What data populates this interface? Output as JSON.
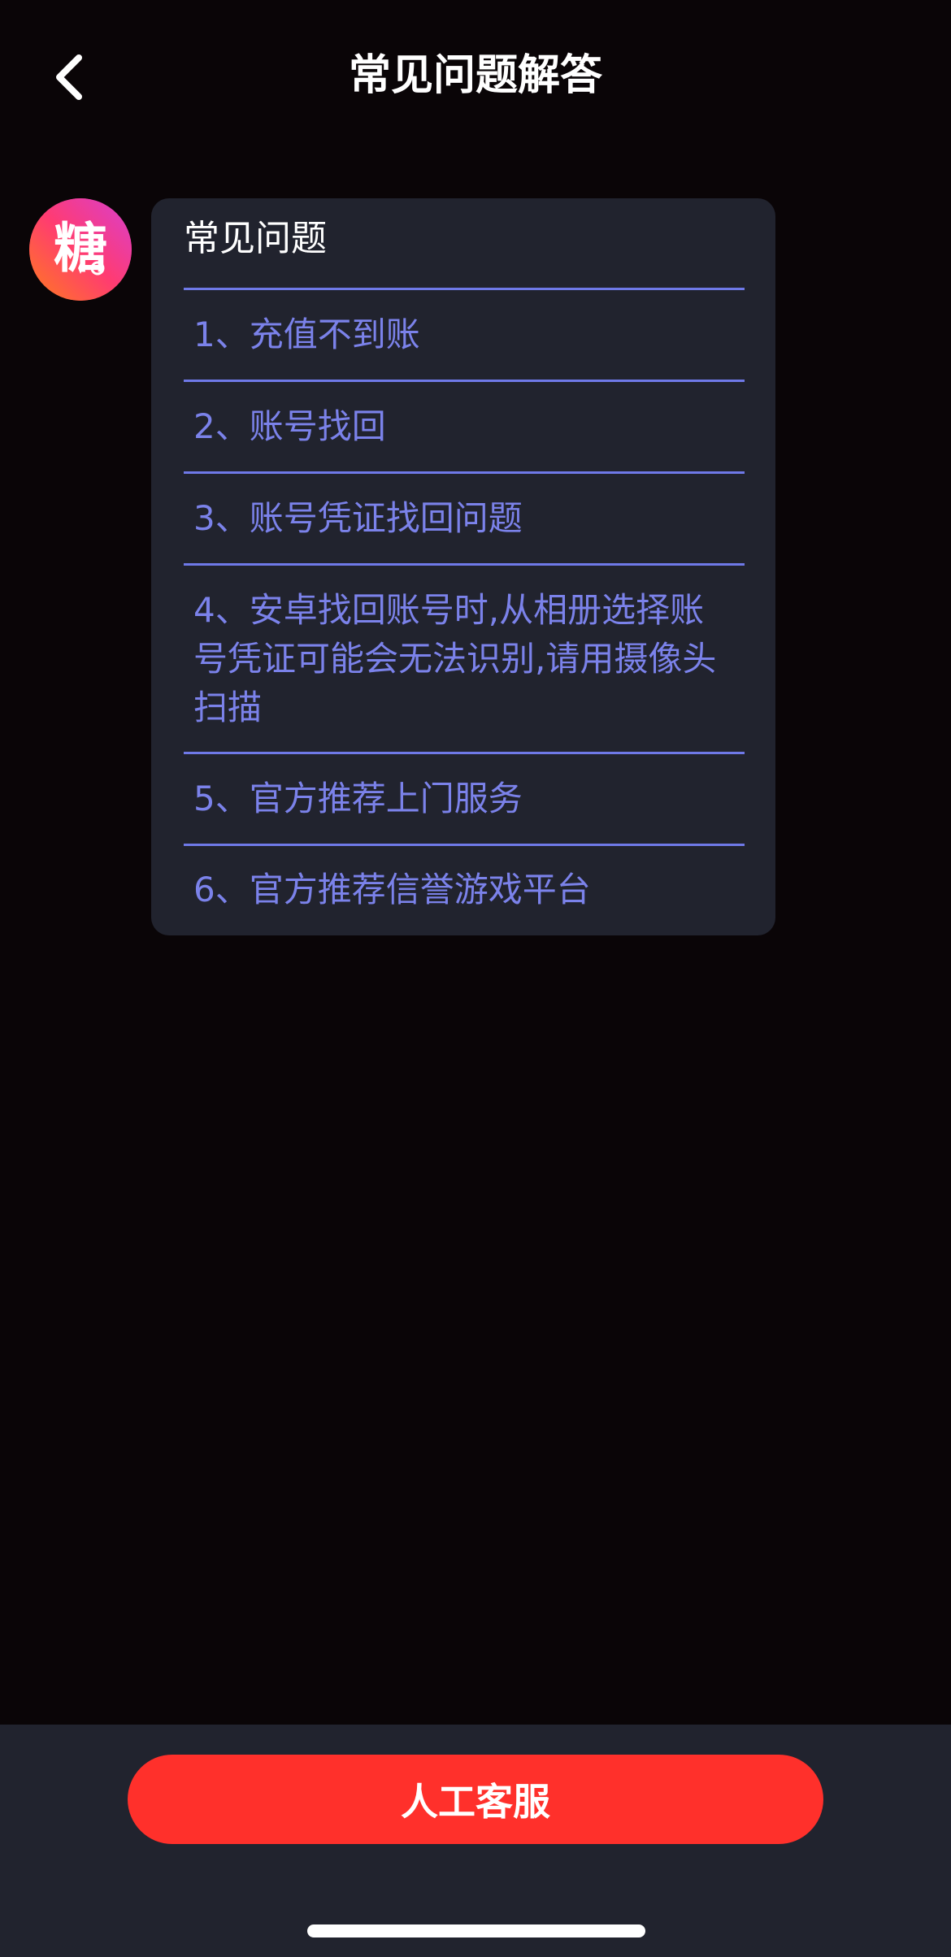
{
  "header": {
    "title": "常见问题解答",
    "back_icon": "chevron-left-icon"
  },
  "avatar": {
    "char": "糖",
    "gradient_colors": [
      "#e43fb4",
      "#ff3a6d",
      "#ff7a1e"
    ]
  },
  "faq": {
    "title": "常见问题",
    "items": [
      "1、充值不到账",
      "2、账号找回",
      "3、账号凭证找回问题",
      "4、安卓找回账号时,从相册选择账号凭证可能会无法识别,请用摄像头扫描",
      "5、官方推荐上门服务",
      "6、官方推荐信誉游戏平台"
    ]
  },
  "bottom": {
    "button_label": "人工客服"
  },
  "colors": {
    "background": "#0a0507",
    "card": "#21232e",
    "link": "#7b82ea",
    "divider": "#6f79e8",
    "button": "#ff302b"
  }
}
